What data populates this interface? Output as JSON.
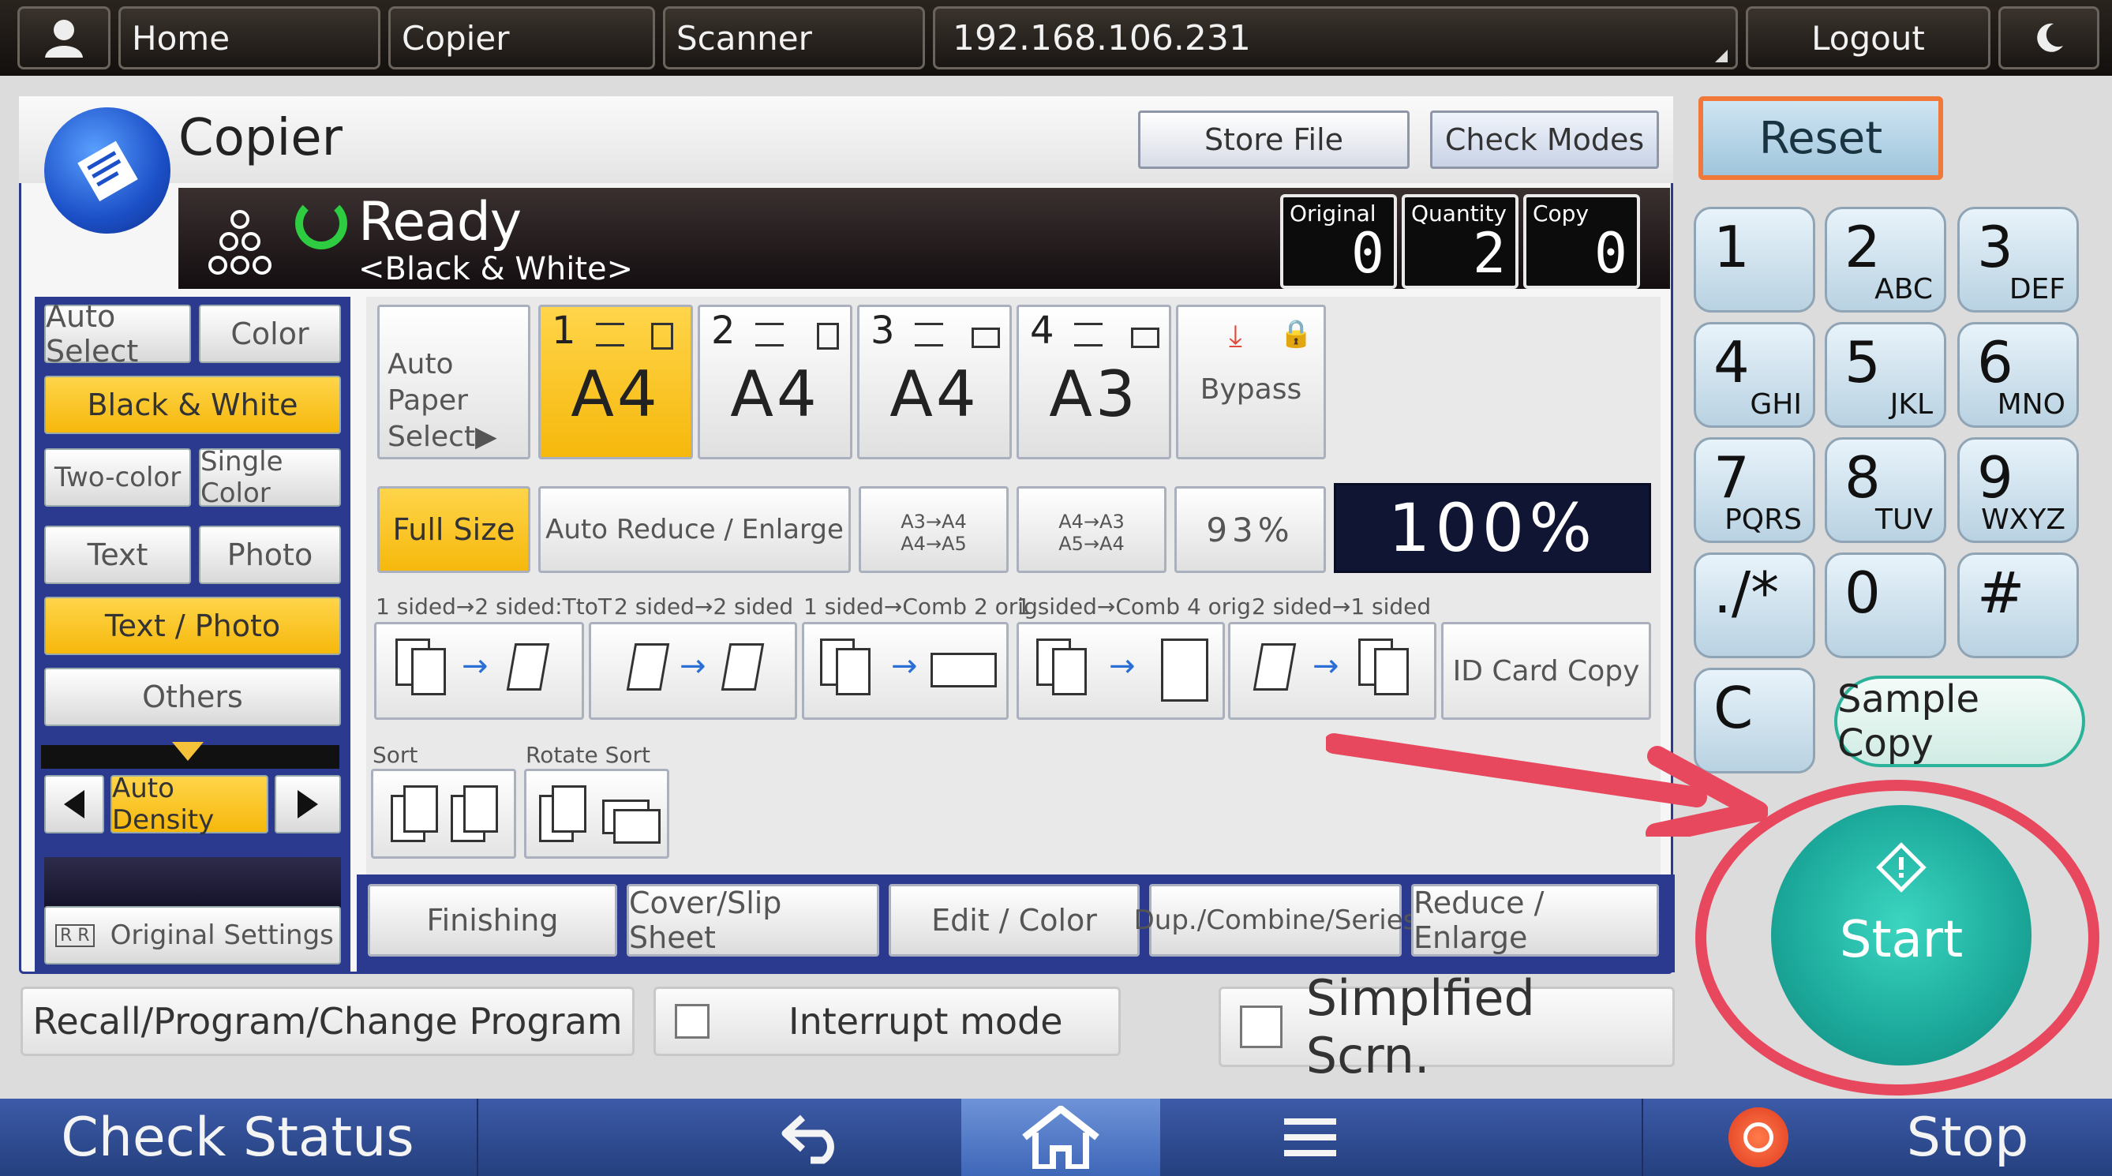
{
  "topbar": {
    "home": "Home",
    "copier": "Copier",
    "scanner": "Scanner",
    "ip": "192.168.106.231",
    "logout": "Logout"
  },
  "header": {
    "title": "Copier",
    "store_file": "Store File",
    "check_modes": "Check Modes"
  },
  "status": {
    "ready": "Ready",
    "mode": "<Black & White>",
    "counters": [
      {
        "label": "Original",
        "value": "0"
      },
      {
        "label": "Quantity",
        "value": "2"
      },
      {
        "label": "Copy",
        "value": "0"
      }
    ]
  },
  "color_mode": {
    "auto_select": "Auto Select",
    "color": "Color",
    "black_white": "Black & White",
    "two_color": "Two-color",
    "single_color": "Single Color"
  },
  "original_type": {
    "text": "Text",
    "photo": "Photo",
    "text_photo": "Text / Photo",
    "others": "Others"
  },
  "density": {
    "label": "Auto Density"
  },
  "original_settings": "Original Settings",
  "paper": {
    "auto_select": "Auto Paper Select▶",
    "trays": [
      {
        "num": "1",
        "size": "A4"
      },
      {
        "num": "2",
        "size": "A4"
      },
      {
        "num": "3",
        "size": "A4"
      },
      {
        "num": "4",
        "size": "A3"
      }
    ],
    "bypass": "Bypass"
  },
  "ratio": {
    "full_size": "Full Size",
    "auto_reduce": "Auto Reduce / Enlarge",
    "preset1_a": "A3→A4",
    "preset1_b": "A4→A5",
    "preset2_a": "A4→A3",
    "preset2_b": "A5→A4",
    "preset3": "93%",
    "current": "100%"
  },
  "duplex": {
    "labels": [
      "1 sided→2 sided:TtoT",
      "2 sided→2 sided",
      "1 sided→Comb 2 orig",
      "1 sided→Comb 4 orig",
      "2 sided→1 sided"
    ],
    "id_card": "ID Card Copy"
  },
  "sort": {
    "sort": "Sort",
    "rotate_sort": "Rotate Sort"
  },
  "tabs": [
    "Finishing",
    "Cover/Slip Sheet",
    "Edit / Color",
    "Dup./Combine/Series",
    "Reduce / Enlarge"
  ],
  "bottom_row": {
    "recall": "Recall/Program/Change Program",
    "interrupt": "Interrupt mode",
    "simplified": "Simplfied Scrn."
  },
  "keypad": {
    "reset": "Reset",
    "keys": [
      {
        "d": "1",
        "l": ""
      },
      {
        "d": "2",
        "l": "ABC"
      },
      {
        "d": "3",
        "l": "DEF"
      },
      {
        "d": "4",
        "l": "GHI"
      },
      {
        "d": "5",
        "l": "JKL"
      },
      {
        "d": "6",
        "l": "MNO"
      },
      {
        "d": "7",
        "l": "PQRS"
      },
      {
        "d": "8",
        "l": "TUV"
      },
      {
        "d": "9",
        "l": "WXYZ"
      },
      {
        "d": "./*",
        "l": ""
      },
      {
        "d": "0",
        "l": ""
      },
      {
        "d": "#",
        "l": ""
      },
      {
        "d": "C",
        "l": ""
      }
    ],
    "sample_copy": "Sample Copy",
    "start": "Start"
  },
  "bottombar": {
    "check_status": "Check Status",
    "stop": "Stop"
  },
  "colors": {
    "accent_blue": "#2b3a8f",
    "selected_yellow": "#f6c23a",
    "start_teal": "#1ba89a",
    "annotation_red": "#e8485e",
    "reset_border": "#f07838"
  }
}
